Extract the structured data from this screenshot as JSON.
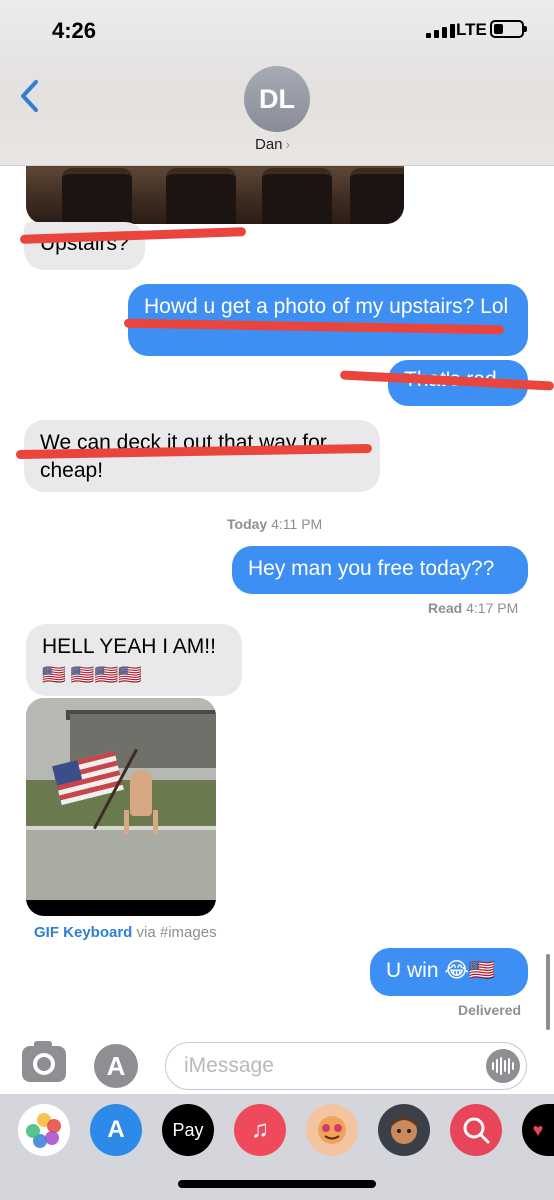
{
  "status_bar": {
    "time": "4:26",
    "network": "LTE"
  },
  "header": {
    "avatar_initials": "DL",
    "contact_name": "Dan",
    "back_icon": "chevron-left-icon"
  },
  "conversation": {
    "msg_upstairs": "Upstairs?",
    "msg_howd": "Howd u get a photo of my upstairs? Lol",
    "msg_thats_rad": "That's rad",
    "msg_deck": "We can deck it out that way for cheap!",
    "timestamp_label": "Today",
    "timestamp_time": "4:11 PM",
    "msg_hey": "Hey man you free today??",
    "read_label": "Read",
    "read_time": "4:17 PM",
    "msg_hell_yeah": "HELL YEAH I AM!!",
    "msg_flags": "🇺🇸 🇺🇸🇺🇸🇺🇸",
    "gif_source": "GIF Keyboard",
    "gif_via": "via #images",
    "msg_u_win": "U win 😂🇺🇸",
    "delivered": "Delivered"
  },
  "input_bar": {
    "placeholder": "iMessage"
  },
  "app_drawer": {
    "apps": [
      "Photos",
      "App Store",
      "Apple Pay",
      "Music",
      "Memoji",
      "Animoji",
      "Search",
      "Digital Touch"
    ],
    "apple_pay_label": "Pay"
  },
  "colors": {
    "outgoing_bubble": "#3d8ff3",
    "incoming_bubble": "#e9e9eb",
    "scribble": "#e9453c",
    "link": "#2f7fd8"
  }
}
